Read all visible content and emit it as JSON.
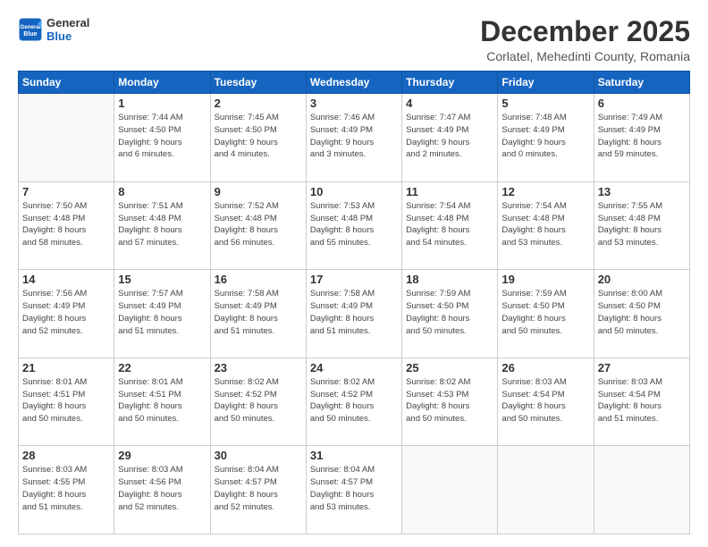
{
  "header": {
    "logo_line1": "General",
    "logo_line2": "Blue",
    "month_title": "December 2025",
    "location": "Corlatel, Mehedinti County, Romania"
  },
  "weekdays": [
    "Sunday",
    "Monday",
    "Tuesday",
    "Wednesday",
    "Thursday",
    "Friday",
    "Saturday"
  ],
  "weeks": [
    [
      {
        "day": "",
        "info": ""
      },
      {
        "day": "1",
        "info": "Sunrise: 7:44 AM\nSunset: 4:50 PM\nDaylight: 9 hours\nand 6 minutes."
      },
      {
        "day": "2",
        "info": "Sunrise: 7:45 AM\nSunset: 4:50 PM\nDaylight: 9 hours\nand 4 minutes."
      },
      {
        "day": "3",
        "info": "Sunrise: 7:46 AM\nSunset: 4:49 PM\nDaylight: 9 hours\nand 3 minutes."
      },
      {
        "day": "4",
        "info": "Sunrise: 7:47 AM\nSunset: 4:49 PM\nDaylight: 9 hours\nand 2 minutes."
      },
      {
        "day": "5",
        "info": "Sunrise: 7:48 AM\nSunset: 4:49 PM\nDaylight: 9 hours\nand 0 minutes."
      },
      {
        "day": "6",
        "info": "Sunrise: 7:49 AM\nSunset: 4:49 PM\nDaylight: 8 hours\nand 59 minutes."
      }
    ],
    [
      {
        "day": "7",
        "info": "Sunrise: 7:50 AM\nSunset: 4:48 PM\nDaylight: 8 hours\nand 58 minutes."
      },
      {
        "day": "8",
        "info": "Sunrise: 7:51 AM\nSunset: 4:48 PM\nDaylight: 8 hours\nand 57 minutes."
      },
      {
        "day": "9",
        "info": "Sunrise: 7:52 AM\nSunset: 4:48 PM\nDaylight: 8 hours\nand 56 minutes."
      },
      {
        "day": "10",
        "info": "Sunrise: 7:53 AM\nSunset: 4:48 PM\nDaylight: 8 hours\nand 55 minutes."
      },
      {
        "day": "11",
        "info": "Sunrise: 7:54 AM\nSunset: 4:48 PM\nDaylight: 8 hours\nand 54 minutes."
      },
      {
        "day": "12",
        "info": "Sunrise: 7:54 AM\nSunset: 4:48 PM\nDaylight: 8 hours\nand 53 minutes."
      },
      {
        "day": "13",
        "info": "Sunrise: 7:55 AM\nSunset: 4:48 PM\nDaylight: 8 hours\nand 53 minutes."
      }
    ],
    [
      {
        "day": "14",
        "info": "Sunrise: 7:56 AM\nSunset: 4:49 PM\nDaylight: 8 hours\nand 52 minutes."
      },
      {
        "day": "15",
        "info": "Sunrise: 7:57 AM\nSunset: 4:49 PM\nDaylight: 8 hours\nand 51 minutes."
      },
      {
        "day": "16",
        "info": "Sunrise: 7:58 AM\nSunset: 4:49 PM\nDaylight: 8 hours\nand 51 minutes."
      },
      {
        "day": "17",
        "info": "Sunrise: 7:58 AM\nSunset: 4:49 PM\nDaylight: 8 hours\nand 51 minutes."
      },
      {
        "day": "18",
        "info": "Sunrise: 7:59 AM\nSunset: 4:50 PM\nDaylight: 8 hours\nand 50 minutes."
      },
      {
        "day": "19",
        "info": "Sunrise: 7:59 AM\nSunset: 4:50 PM\nDaylight: 8 hours\nand 50 minutes."
      },
      {
        "day": "20",
        "info": "Sunrise: 8:00 AM\nSunset: 4:50 PM\nDaylight: 8 hours\nand 50 minutes."
      }
    ],
    [
      {
        "day": "21",
        "info": "Sunrise: 8:01 AM\nSunset: 4:51 PM\nDaylight: 8 hours\nand 50 minutes."
      },
      {
        "day": "22",
        "info": "Sunrise: 8:01 AM\nSunset: 4:51 PM\nDaylight: 8 hours\nand 50 minutes."
      },
      {
        "day": "23",
        "info": "Sunrise: 8:02 AM\nSunset: 4:52 PM\nDaylight: 8 hours\nand 50 minutes."
      },
      {
        "day": "24",
        "info": "Sunrise: 8:02 AM\nSunset: 4:52 PM\nDaylight: 8 hours\nand 50 minutes."
      },
      {
        "day": "25",
        "info": "Sunrise: 8:02 AM\nSunset: 4:53 PM\nDaylight: 8 hours\nand 50 minutes."
      },
      {
        "day": "26",
        "info": "Sunrise: 8:03 AM\nSunset: 4:54 PM\nDaylight: 8 hours\nand 50 minutes."
      },
      {
        "day": "27",
        "info": "Sunrise: 8:03 AM\nSunset: 4:54 PM\nDaylight: 8 hours\nand 51 minutes."
      }
    ],
    [
      {
        "day": "28",
        "info": "Sunrise: 8:03 AM\nSunset: 4:55 PM\nDaylight: 8 hours\nand 51 minutes."
      },
      {
        "day": "29",
        "info": "Sunrise: 8:03 AM\nSunset: 4:56 PM\nDaylight: 8 hours\nand 52 minutes."
      },
      {
        "day": "30",
        "info": "Sunrise: 8:04 AM\nSunset: 4:57 PM\nDaylight: 8 hours\nand 52 minutes."
      },
      {
        "day": "31",
        "info": "Sunrise: 8:04 AM\nSunset: 4:57 PM\nDaylight: 8 hours\nand 53 minutes."
      },
      {
        "day": "",
        "info": ""
      },
      {
        "day": "",
        "info": ""
      },
      {
        "day": "",
        "info": ""
      }
    ]
  ]
}
